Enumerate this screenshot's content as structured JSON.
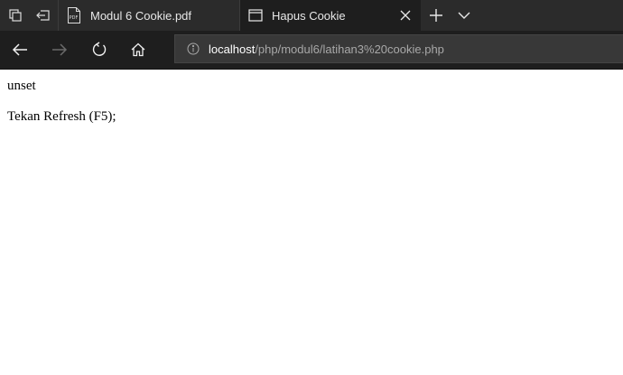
{
  "browser": {
    "tabs": [
      {
        "title": "Modul 6 Cookie.pdf",
        "icon": "pdf-icon",
        "active": false
      },
      {
        "title": "Hapus Cookie",
        "icon": "page-icon",
        "active": true
      }
    ],
    "address_bar": {
      "host": "localhost",
      "path": "/php/modul6/latihan3%20cookie.php"
    },
    "colors": {
      "tabbar_bg": "#2b2b2b",
      "toolbar_bg": "#1e1e1e",
      "address_bg": "#383838"
    }
  },
  "page": {
    "lines": [
      "unset",
      "Tekan Refresh (F5);"
    ]
  }
}
